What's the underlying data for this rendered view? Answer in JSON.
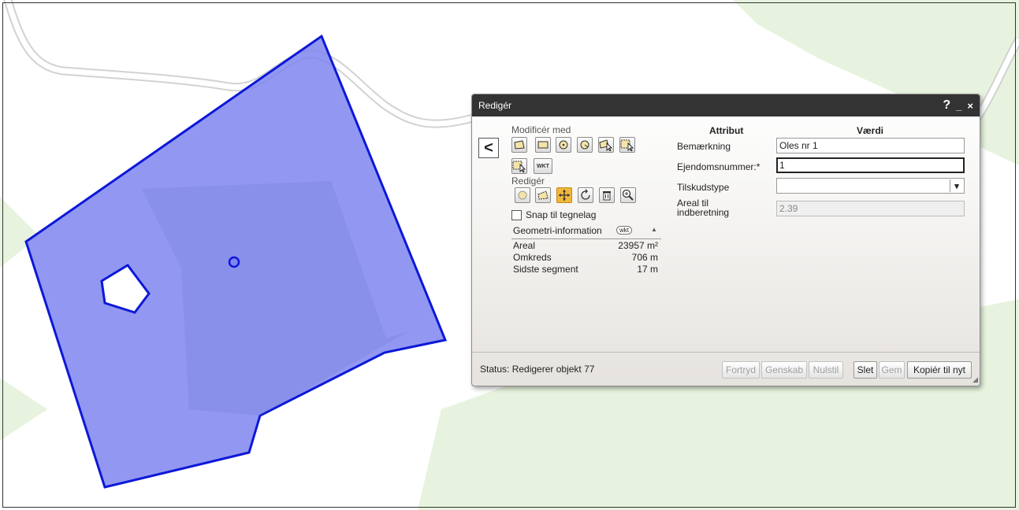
{
  "dialog": {
    "title": "Redigér",
    "help_label": "?",
    "minimize_label": "_",
    "close_label": "×",
    "back_label": "<"
  },
  "tools": {
    "modify_label": "Modificér med",
    "edit_label": "Redigér",
    "wkt_label": "WKT",
    "snap_label": "Snap til tegnelag",
    "snap_checked": false
  },
  "geometry": {
    "title": "Geometri-information",
    "wkt_label": "wkt",
    "collapse_icon": "▲",
    "rows": [
      {
        "label": "Areal",
        "value": "23957 m²"
      },
      {
        "label": "Omkreds",
        "value": "706 m"
      },
      {
        "label": "Sidste segment",
        "value": "17 m"
      }
    ]
  },
  "attributes": {
    "attr_header": "Attribut",
    "value_header": "Værdi",
    "bemaerkning": {
      "label": "Bemærkning",
      "value": "Oles nr 1"
    },
    "ejendom": {
      "label": "Ejendomsnummer:*",
      "value": "1"
    },
    "tilskud": {
      "label": "Tilskudstype",
      "value": ""
    },
    "areal": {
      "label_line1": "Areal til",
      "label_line2": "indberetning",
      "value": "2.39"
    }
  },
  "footer": {
    "status": "Status: Redigerer objekt 77",
    "buttons": {
      "fortryd": "Fortryd",
      "genskab": "Genskab",
      "nulstil": "Nulstil",
      "slet": "Slet",
      "gem": "Gem",
      "kopier": "Kopiér til nyt"
    }
  },
  "colors": {
    "polygon_fill": "#7f86ee",
    "polygon_stroke": "#0d18d8",
    "forest": "#e7f3de",
    "active_tool": "#f0b73a"
  }
}
